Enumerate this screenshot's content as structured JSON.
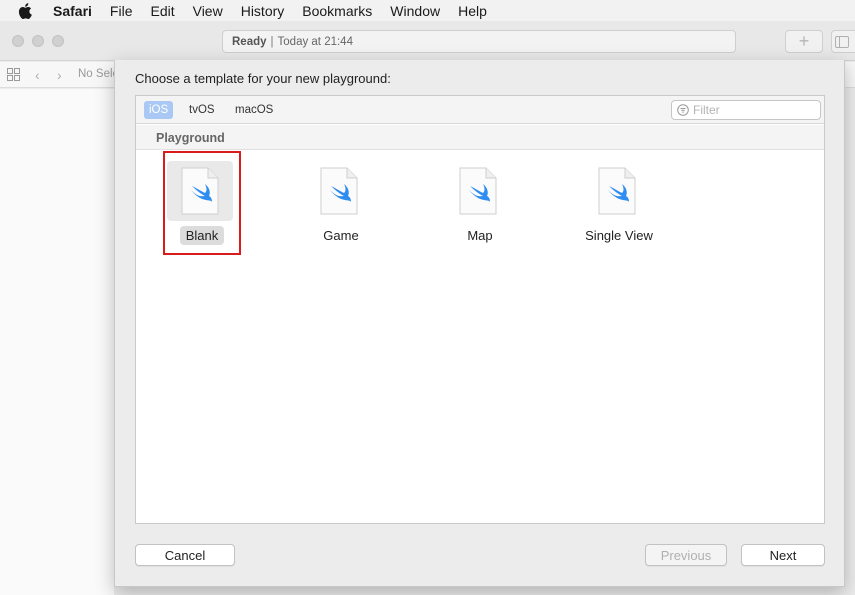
{
  "menubar": {
    "app": "Safari",
    "items": [
      "File",
      "Edit",
      "View",
      "History",
      "Bookmarks",
      "Window",
      "Help"
    ]
  },
  "window": {
    "status_strong": "Ready",
    "status_sep": "|",
    "status_text": "Today at 21:44",
    "plus_label": "+"
  },
  "navbar": {
    "label": "No Selection"
  },
  "sheet": {
    "title": "Choose a template for your new playground:",
    "platforms": [
      {
        "label": "iOS",
        "active": true
      },
      {
        "label": "tvOS",
        "active": false
      },
      {
        "label": "macOS",
        "active": false
      }
    ],
    "filter_placeholder": "Filter",
    "section": "Playground",
    "templates": [
      {
        "label": "Blank",
        "selected": true,
        "icon": "swift-file-icon"
      },
      {
        "label": "Game",
        "selected": false,
        "icon": "swift-file-icon"
      },
      {
        "label": "Map",
        "selected": false,
        "icon": "swift-file-icon"
      },
      {
        "label": "Single View",
        "selected": false,
        "icon": "swift-file-icon"
      }
    ],
    "buttons": {
      "cancel": "Cancel",
      "previous": "Previous",
      "next": "Next"
    }
  },
  "colors": {
    "accent": "#a9c9f4",
    "swift": "#2f8cf0",
    "highlight": "#d81b1b"
  }
}
